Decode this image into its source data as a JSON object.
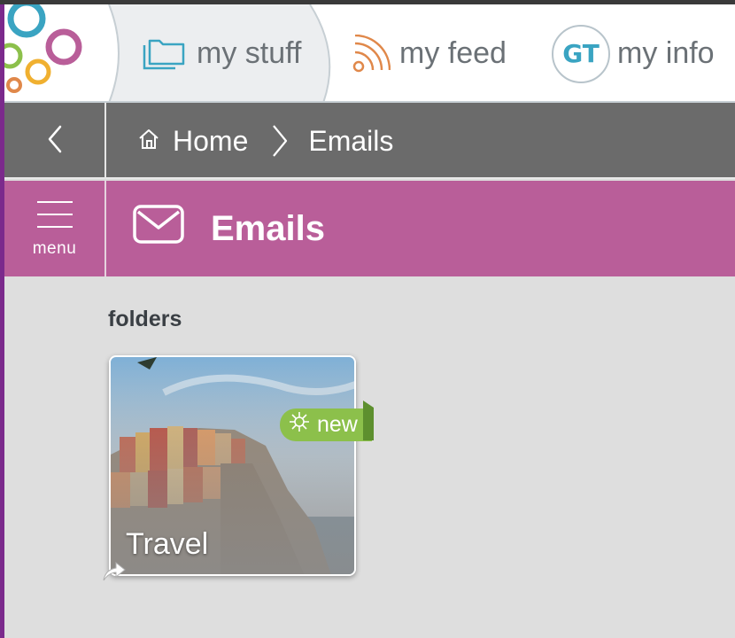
{
  "topnav": {
    "tabs": [
      {
        "label": "my stuff",
        "icon": "folders-icon",
        "active": true
      },
      {
        "label": "my feed",
        "icon": "rss-feed-icon",
        "active": false
      },
      {
        "label": "my info",
        "icon": "avatar",
        "active": false
      }
    ],
    "avatar_initials": "GT",
    "colors": {
      "tab_text": "#6b7176",
      "feed_icon": "#e0884a",
      "stuff_icon": "#3aa4c2",
      "avatar_text": "#3aa4c2"
    }
  },
  "breadcrumb": {
    "items": [
      "Home",
      "Emails"
    ],
    "bar_color": "#6b6b6b"
  },
  "titlebar": {
    "menu_label": "menu",
    "title": "Emails",
    "icon": "envelope-icon",
    "color": "#b95e99"
  },
  "content": {
    "section_label": "folders",
    "folders": [
      {
        "name": "Travel",
        "badge": "new",
        "badge_color": "#8cc04b",
        "shortcut": true
      }
    ]
  }
}
